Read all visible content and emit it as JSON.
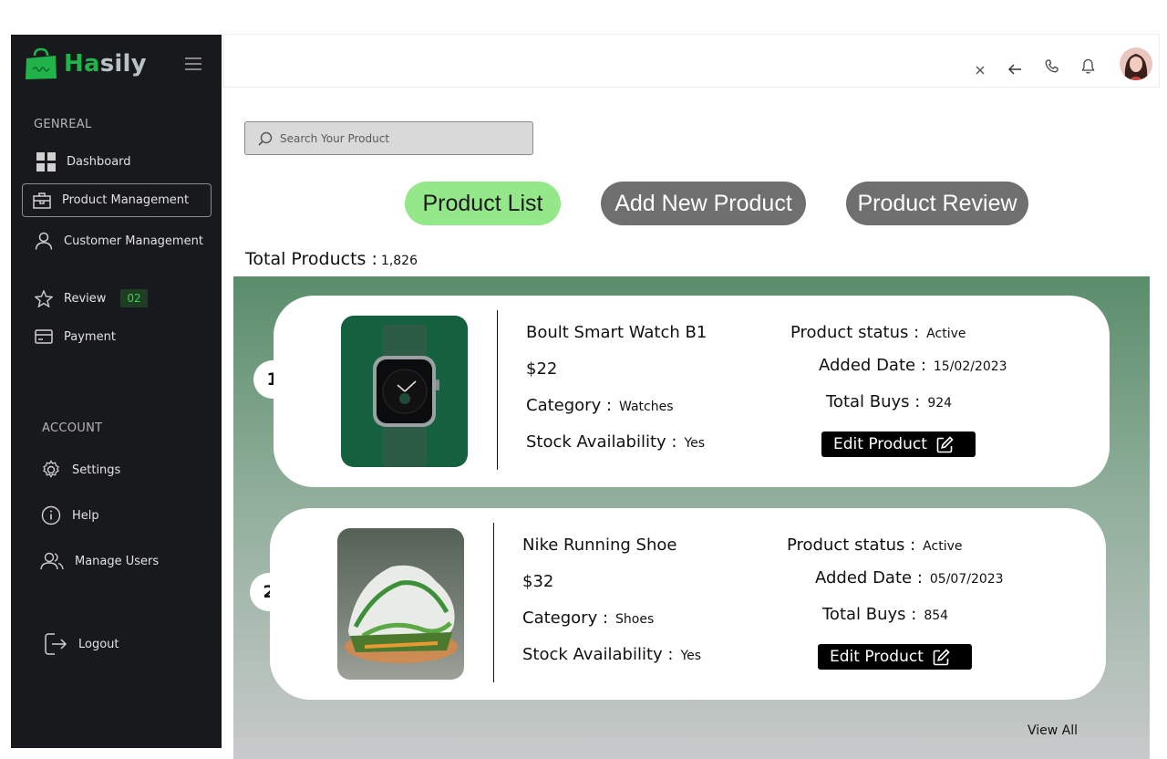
{
  "brand": {
    "name_part1": "Ha",
    "name_part2": "sily"
  },
  "sidebar": {
    "general_label": "GENREAL",
    "account_label": "ACCOUNT",
    "items": [
      {
        "label": "Dashboard",
        "icon": "grid-icon"
      },
      {
        "label": "Product Management",
        "icon": "briefcase-icon"
      },
      {
        "label": "Customer Management",
        "icon": "user-icon"
      },
      {
        "label": "Review",
        "icon": "star-icon",
        "badge": "02"
      },
      {
        "label": "Payment",
        "icon": "card-icon"
      }
    ],
    "account_items": [
      {
        "label": "Settings",
        "icon": "gear-icon"
      },
      {
        "label": "Help",
        "icon": "info-icon"
      },
      {
        "label": "Manage Users",
        "icon": "users-icon"
      }
    ],
    "logout_label": "Logout"
  },
  "search": {
    "placeholder": "Search Your Product"
  },
  "tabs": [
    "Product List",
    "Add New Product",
    "Product Review"
  ],
  "total": {
    "label": "Total Products :",
    "value": "1,826"
  },
  "fields": {
    "status": "Product status :",
    "added": "Added Date :",
    "buys": "Total Buys :",
    "category": "Category :",
    "stock": "Stock Availability :",
    "edit": "Edit Product"
  },
  "products": [
    {
      "num": "1",
      "name": "Boult Smart Watch B1",
      "price": "$22",
      "category": "Watches",
      "stock": "Yes",
      "status": "Active",
      "added": "15/02/2023",
      "buys": "924"
    },
    {
      "num": "2",
      "name": "Nike Running Shoe",
      "price": "$32",
      "category": "Shoes",
      "stock": "Yes",
      "status": "Active",
      "added": "05/07/2023",
      "buys": "854"
    }
  ],
  "view_all": "View All",
  "colors": {
    "sidebar": "#18191d",
    "brand_green": "#1fb34a",
    "active_tab": "#95e88a",
    "inactive_tab": "#6f6f6f"
  }
}
